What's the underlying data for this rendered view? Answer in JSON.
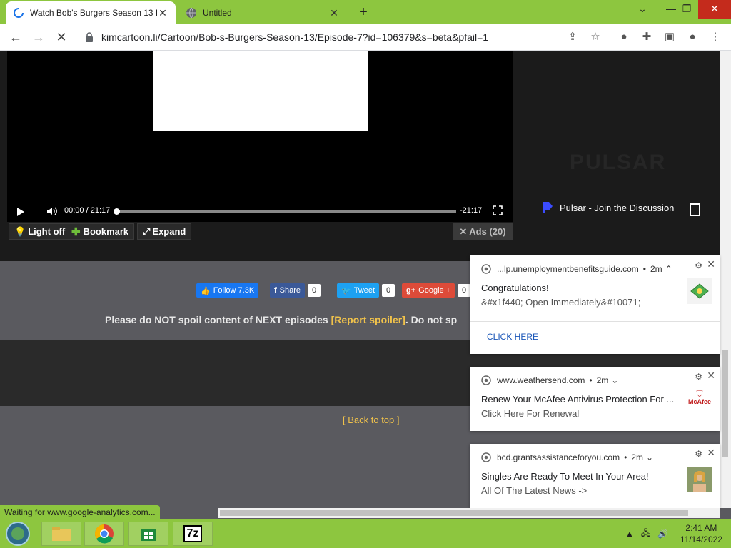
{
  "browser": {
    "tabs": [
      {
        "title": "Watch Bob's Burgers Season 13 E",
        "active": true,
        "state": "loading"
      },
      {
        "title": "Untitled",
        "active": false
      }
    ],
    "new_tab": "+",
    "url": "kimcartoon.li/Cartoon/Bob-s-Burgers-Season-13/Episode-7?id=106379&s=beta&pfail=1"
  },
  "player": {
    "current_time": "00:00",
    "separator": "/",
    "duration": "21:17",
    "remaining": "-21:17",
    "progress": 0.0
  },
  "player_buttons": {
    "light_off": "Light off",
    "bookmark": "Bookmark",
    "expand": "Expand",
    "ads": "Ads (20)"
  },
  "pulsar": {
    "watermark": "PULSAR",
    "label": "Pulsar - Join the Discussion"
  },
  "social": {
    "facebook_follow": "Follow 7.3K",
    "facebook_share": "Share",
    "share_count": "0",
    "tweet": "Tweet",
    "tweet_count": "0",
    "google": "Google +",
    "google_count": "0"
  },
  "notice": {
    "before": "Please do NOT spoil content of NEXT episodes ",
    "link": "[Report spoiler]",
    "after": ". Do not sp"
  },
  "back_to_top": "[ Back to top ]",
  "notifications": [
    {
      "source": "...lp.unemploymentbenefitsguide.com",
      "time": "2m",
      "title": "Congratulations!",
      "body": "&#x1f440; Open Immediately&#10071;",
      "action": "CLICK HERE"
    },
    {
      "source": "www.weathersend.com",
      "time": "2m",
      "title": "Renew Your McAfee Antivirus Protection For ...",
      "body": "Click Here For Renewal",
      "brand": "McAfee"
    },
    {
      "source": "bcd.grantsassistanceforyou.com",
      "time": "2m",
      "title": "Singles Are Ready To Meet In Your Area!",
      "body": "All Of The Latest News ->"
    }
  ],
  "status_text": "Waiting for www.google-analytics.com...",
  "taskbar": {
    "time": "2:41 AM",
    "date": "11/14/2022"
  },
  "colors": {
    "chrome_frame": "#8dc63f",
    "spoiler_link": "#f0c24b",
    "facebook": "#1877f2",
    "twitter": "#1da1f2",
    "google": "#dd4b39"
  }
}
